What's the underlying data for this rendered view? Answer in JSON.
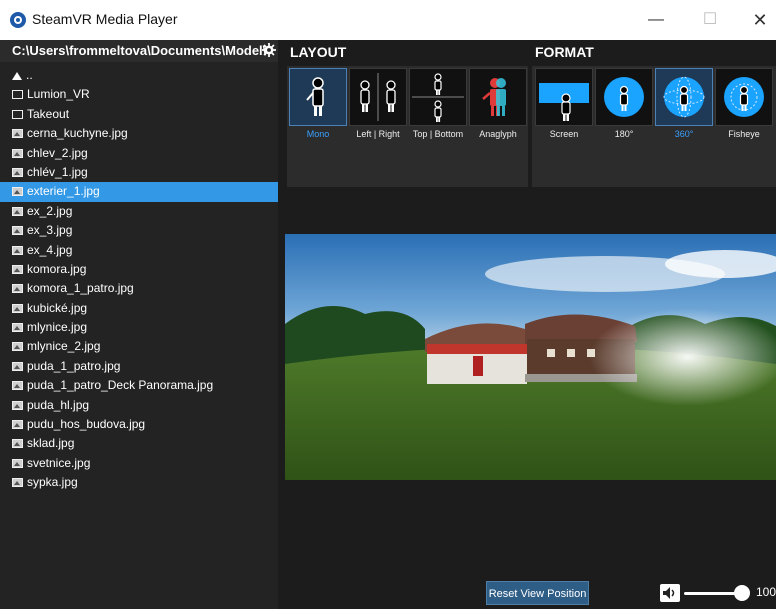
{
  "window": {
    "title": "SteamVR Media Player",
    "min": "—",
    "max": "☐",
    "close": "✕"
  },
  "browser": {
    "path": "C:\\Users\\frommeltova\\Documents\\Model\\",
    "up_label": "..",
    "items": [
      {
        "name": "Lumion_VR",
        "type": "folder"
      },
      {
        "name": "Takeout",
        "type": "folder"
      },
      {
        "name": "cerna_kuchyne.jpg",
        "type": "image"
      },
      {
        "name": "chlev_2.jpg",
        "type": "image"
      },
      {
        "name": "chlév_1.jpg",
        "type": "image"
      },
      {
        "name": "exterier_1.jpg",
        "type": "image",
        "selected": true
      },
      {
        "name": "ex_2.jpg",
        "type": "image"
      },
      {
        "name": "ex_3.jpg",
        "type": "image"
      },
      {
        "name": "ex_4.jpg",
        "type": "image"
      },
      {
        "name": "komora.jpg",
        "type": "image"
      },
      {
        "name": "komora_1_patro.jpg",
        "type": "image"
      },
      {
        "name": "kubické.jpg",
        "type": "image"
      },
      {
        "name": "mlynice.jpg",
        "type": "image"
      },
      {
        "name": "mlynice_2.jpg",
        "type": "image"
      },
      {
        "name": "puda_1_patro.jpg",
        "type": "image"
      },
      {
        "name": "puda_1_patro_Deck Panorama.jpg",
        "type": "image"
      },
      {
        "name": "puda_hl.jpg",
        "type": "image"
      },
      {
        "name": "pudu_hos_budova.jpg",
        "type": "image"
      },
      {
        "name": "sklad.jpg",
        "type": "image"
      },
      {
        "name": "svetnice.jpg",
        "type": "image"
      },
      {
        "name": "sypka.jpg",
        "type": "image"
      }
    ]
  },
  "layout": {
    "heading": "LAYOUT",
    "options": [
      {
        "label": "Mono",
        "selected": true
      },
      {
        "label": "Left | Right"
      },
      {
        "label": "Top | Bottom"
      },
      {
        "label": "Anaglyph"
      }
    ]
  },
  "format": {
    "heading": "FORMAT",
    "options": [
      {
        "label": "Screen"
      },
      {
        "label": "180°"
      },
      {
        "label": "360°",
        "selected": true
      },
      {
        "label": "Fisheye"
      }
    ]
  },
  "controls": {
    "reset_label": "Reset View Position",
    "volume": 100,
    "volume_text": "100"
  },
  "colors": {
    "accent": "#3399e6",
    "selected_label": "#3aa0ff",
    "panel": "#2c2c2c",
    "button": "#2e5d86"
  }
}
